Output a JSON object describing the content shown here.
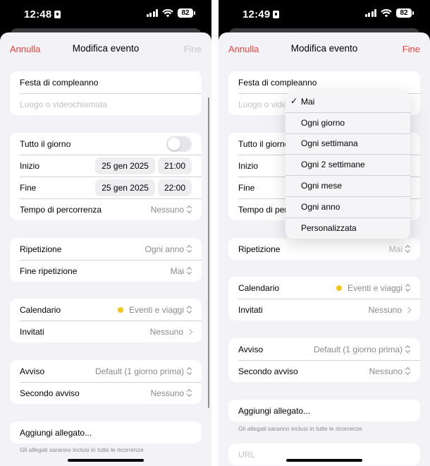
{
  "left": {
    "status": {
      "time": "12:48",
      "battery": "82"
    },
    "nav": {
      "cancel": "Annulla",
      "title": "Modifica evento",
      "done": "Fine"
    },
    "event": {
      "title": "Festa di compleanno",
      "location_placeholder": "Luogo o videochiamata"
    },
    "all_day": {
      "label": "Tutto il giorno",
      "on": false
    },
    "start": {
      "label": "Inizio",
      "date": "25 gen 2025",
      "time": "21:00"
    },
    "end": {
      "label": "Fine",
      "date": "25 gen 2025",
      "time": "22:00"
    },
    "travel": {
      "label": "Tempo di percorrenza",
      "value": "Nessuno"
    },
    "repeat": {
      "label": "Ripetizione",
      "value": "Ogni anno"
    },
    "repeat_end": {
      "label": "Fine ripetizione",
      "value": "Mai"
    },
    "calendar": {
      "label": "Calendario",
      "value": "Eventi e viaggi",
      "color": "#f5c518"
    },
    "invitees": {
      "label": "Invitati",
      "value": "Nessuno"
    },
    "alert": {
      "label": "Avviso",
      "value": "Default (1 giorno prima)"
    },
    "second_alert": {
      "label": "Secondo avviso",
      "value": "Nessuno"
    },
    "attachment": {
      "label": "Aggiungi allegato...",
      "note": "Gli allegati saranno inclusi in tutte le ricorrenze"
    }
  },
  "right": {
    "status": {
      "time": "12:49",
      "battery": "82"
    },
    "nav": {
      "cancel": "Annulla",
      "title": "Modifica evento",
      "done": "Fine"
    },
    "event": {
      "title": "Festa di compleanno",
      "location_placeholder": "Luogo o videoc"
    },
    "all_day": {
      "label": "Tutto il giorno"
    },
    "start": {
      "label": "Inizio"
    },
    "end": {
      "label": "Fine"
    },
    "travel": {
      "label": "Tempo di perc"
    },
    "repeat_menu": {
      "selected": "Mai",
      "options": [
        "Mai",
        "Ogni giorno",
        "Ogni settimana",
        "Ogni 2 settimane",
        "Ogni mese",
        "Ogni anno",
        "Personalizzata"
      ]
    },
    "repeat": {
      "label": "Ripetizione",
      "value": "Mai"
    },
    "calendar": {
      "label": "Calendario",
      "value": "Eventi e viaggi",
      "color": "#f5c518"
    },
    "invitees": {
      "label": "Invitati",
      "value": "Nessuno"
    },
    "alert": {
      "label": "Avviso",
      "value": "Default (1 giorno prima)"
    },
    "second_alert": {
      "label": "Secondo avviso",
      "value": "Nessuno"
    },
    "attachment": {
      "label": "Aggiungi allegato...",
      "note": "Gli allegati saranno inclusi in tutte le ricorrenze"
    },
    "url": {
      "placeholder": "URL"
    }
  },
  "colors": {
    "accent": "#f2423b",
    "background": "#f2f2f7",
    "calendar_dot": "#f5c518"
  }
}
